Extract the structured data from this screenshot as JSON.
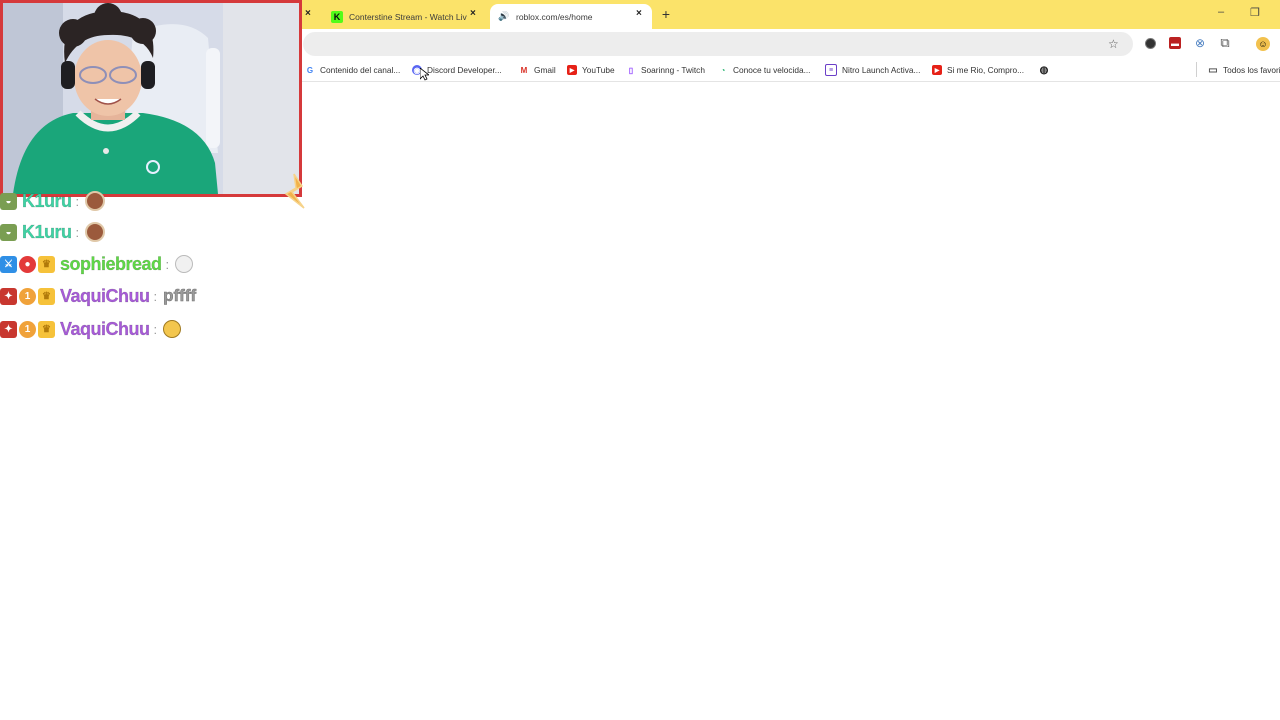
{
  "browser": {
    "tabs": [
      {
        "title": "Conterstine Stream - Watch Live",
        "favicon": "kick-icon",
        "active": false
      },
      {
        "title": "roblox.com/es/home",
        "favicon": "speaker-icon",
        "active": true
      }
    ],
    "new_tab_symbol": "+",
    "close_symbol": "×",
    "address": "",
    "window_controls": {
      "minimize": "–",
      "restore": "❐"
    },
    "extensions": [
      "record-icon",
      "pdf-icon",
      "translate-icon",
      "puzzle-icon",
      "profile-icon"
    ]
  },
  "bookmarks": {
    "items": [
      {
        "label": "Contenido del canal...",
        "icon": "google-icon"
      },
      {
        "label": "Discord Developer...",
        "icon": "discord-icon"
      },
      {
        "label": "Gmail",
        "icon": "gmail-icon"
      },
      {
        "label": "YouTube",
        "icon": "youtube-icon"
      },
      {
        "label": "Soarinng - Twitch",
        "icon": "twitch-icon"
      },
      {
        "label": "Conoce tu velocida...",
        "icon": "speedtest-icon"
      },
      {
        "label": "Nitro Launch Activa...",
        "icon": "nitro-icon"
      },
      {
        "label": "Si me Rio, Compro...",
        "icon": "youtube-icon"
      },
      {
        "label": "",
        "icon": "globe-icon"
      }
    ],
    "all_bookmarks_label": "Todos los favoritos"
  },
  "chat": {
    "separator": ":",
    "messages": [
      {
        "user": "K1uru",
        "color": "#3fd3a4",
        "badges": [
          "pot-badge"
        ],
        "text": "",
        "emote": "face-emote"
      },
      {
        "user": "K1uru",
        "color": "#3fd3a4",
        "badges": [
          "pot-badge"
        ],
        "text": "",
        "emote": "face-emote"
      },
      {
        "user": "sophiebread",
        "color": "#5fd846",
        "badges": [
          "moderator-badge",
          "strawberry-badge",
          "crown-badge"
        ],
        "text": "",
        "emote": "hand-emote"
      },
      {
        "user": "VaquiChuu",
        "color": "#a75bd8",
        "badges": [
          "sword-badge",
          "number-one-badge",
          "crown-badge"
        ],
        "text": "pffff",
        "emote": ""
      },
      {
        "user": "VaquiChuu",
        "color": "#a75bd8",
        "badges": [
          "sword-badge",
          "number-one-badge",
          "crown-badge"
        ],
        "text": "",
        "emote": "laughing-emote"
      }
    ]
  },
  "colors": {
    "tabstrip": "#fbe36a",
    "webcam_border": "#d5393b",
    "shirt": "#1aa67a"
  }
}
